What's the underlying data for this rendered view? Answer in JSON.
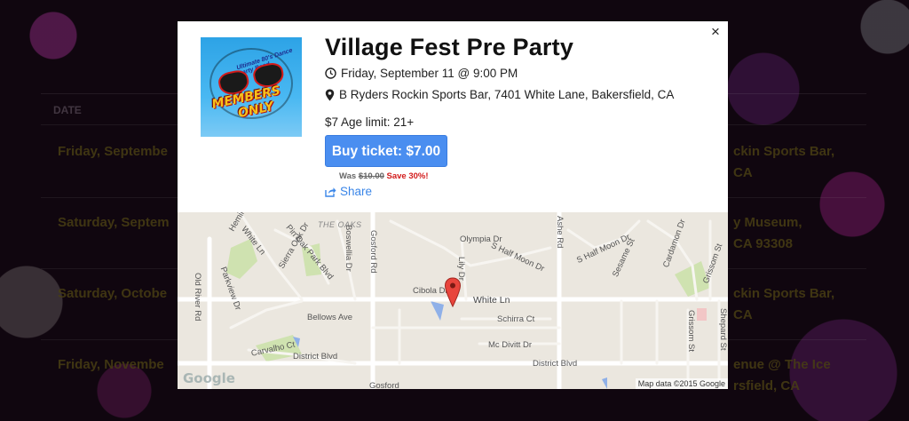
{
  "background": {
    "header_date": "DATE",
    "rows": [
      {
        "left": "Friday, Septembe",
        "right": "ckin Sports Bar,"
      },
      {
        "left": "",
        "right": "CA"
      },
      {
        "left": "Saturday, Septem",
        "right": "y Museum,"
      },
      {
        "left": "",
        "right": "CA 93308"
      },
      {
        "left": "Saturday, Octobe",
        "right": "ckin Sports Bar,"
      },
      {
        "left": "",
        "right": "CA"
      },
      {
        "left": "Friday, Novembe",
        "right": "enue @ The Ice"
      },
      {
        "left": "",
        "right": "rsfield, CA"
      }
    ]
  },
  "event": {
    "title": "Village Fest Pre Party",
    "datetime": "Friday, September 11 @ 9:00 PM",
    "location": "B Ryders Rockin Sports Bar, 7401 White Lane, Bakersfield, CA",
    "price_info": "$7 Age limit: 21+",
    "buy_label": "Buy ticket: $7.00",
    "was_label": "Was",
    "was_price": "$10.00",
    "save_label": "Save 30%!",
    "share_label": "Share",
    "close_label": "×"
  },
  "logo": {
    "tagline": "Ultimate 80's Dance Party Band",
    "word1": "MEMBERS",
    "word2": "ONLY"
  },
  "map": {
    "labels": {
      "the_oaks": "THE OAKS",
      "white_ln_nw": "White Ln",
      "pin_oak_park": "Pin Oak Park Blvd",
      "hemingway": "Hemingway Pl",
      "sierra_oak": "Sierra Oak Dr",
      "parkview": "Parkview Dr",
      "boswellia": "Boswellia Dr",
      "gosford_rd": "Gosford Rd",
      "olympia": "Olympia Dr",
      "lily": "Lily Dr",
      "half_moon_1": "S Half Moon Dr",
      "ashe": "Ashe Rd",
      "half_moon_2": "S Half Moon Dr",
      "sesame": "Sesame St",
      "cardamon": "Cardamon Dr",
      "grissom_st": "Grissom St",
      "old_river": "Old River Rd",
      "cibola": "Cibola Dr",
      "white_ln": "White Ln",
      "bellows": "Bellows Ave",
      "schirra": "Schirra Ct",
      "grissom_st2": "Grissom St",
      "shepard": "Shepard St",
      "carvalho": "Carvalho Ct",
      "mc_divitt": "Mc Divitt Dr",
      "district_1": "District Blvd",
      "district_2": "District Blvd",
      "gosford_bottom": "Gosford"
    },
    "google": "Google",
    "attribution": "Map data ©2015 Google"
  }
}
